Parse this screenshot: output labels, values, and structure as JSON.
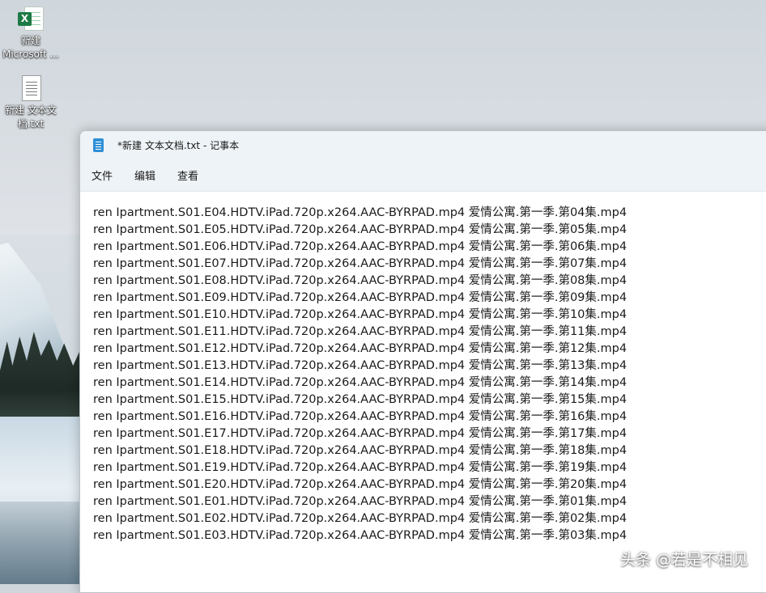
{
  "desktop": {
    "icons": [
      {
        "name": "excel-file",
        "label_line1": "新建",
        "label_line2": "Microsoft ...",
        "badge": "X"
      },
      {
        "name": "text-file",
        "label_line1": "新建 文本文",
        "label_line2": "档.txt"
      }
    ]
  },
  "window": {
    "title": "*新建 文本文档.txt - 记事本",
    "menu": [
      "文件",
      "编辑",
      "查看"
    ]
  },
  "editor": {
    "lines": [
      "ren Ipartment.S01.E04.HDTV.iPad.720p.x264.AAC-BYRPAD.mp4 爱情公寓.第一季.第04集.mp4",
      "ren Ipartment.S01.E05.HDTV.iPad.720p.x264.AAC-BYRPAD.mp4 爱情公寓.第一季.第05集.mp4",
      "ren Ipartment.S01.E06.HDTV.iPad.720p.x264.AAC-BYRPAD.mp4 爱情公寓.第一季.第06集.mp4",
      "ren Ipartment.S01.E07.HDTV.iPad.720p.x264.AAC-BYRPAD.mp4 爱情公寓.第一季.第07集.mp4",
      "ren Ipartment.S01.E08.HDTV.iPad.720p.x264.AAC-BYRPAD.mp4 爱情公寓.第一季.第08集.mp4",
      "ren Ipartment.S01.E09.HDTV.iPad.720p.x264.AAC-BYRPAD.mp4 爱情公寓.第一季.第09集.mp4",
      "ren Ipartment.S01.E10.HDTV.iPad.720p.x264.AAC-BYRPAD.mp4 爱情公寓.第一季.第10集.mp4",
      "ren Ipartment.S01.E11.HDTV.iPad.720p.x264.AAC-BYRPAD.mp4 爱情公寓.第一季.第11集.mp4",
      "ren Ipartment.S01.E12.HDTV.iPad.720p.x264.AAC-BYRPAD.mp4 爱情公寓.第一季.第12集.mp4",
      "ren Ipartment.S01.E13.HDTV.iPad.720p.x264.AAC-BYRPAD.mp4 爱情公寓.第一季.第13集.mp4",
      "ren Ipartment.S01.E14.HDTV.iPad.720p.x264.AAC-BYRPAD.mp4 爱情公寓.第一季.第14集.mp4",
      "ren Ipartment.S01.E15.HDTV.iPad.720p.x264.AAC-BYRPAD.mp4 爱情公寓.第一季.第15集.mp4",
      "ren Ipartment.S01.E16.HDTV.iPad.720p.x264.AAC-BYRPAD.mp4 爱情公寓.第一季.第16集.mp4",
      "ren Ipartment.S01.E17.HDTV.iPad.720p.x264.AAC-BYRPAD.mp4 爱情公寓.第一季.第17集.mp4",
      "ren Ipartment.S01.E18.HDTV.iPad.720p.x264.AAC-BYRPAD.mp4 爱情公寓.第一季.第18集.mp4",
      "ren Ipartment.S01.E19.HDTV.iPad.720p.x264.AAC-BYRPAD.mp4 爱情公寓.第一季.第19集.mp4",
      "ren Ipartment.S01.E20.HDTV.iPad.720p.x264.AAC-BYRPAD.mp4 爱情公寓.第一季.第20集.mp4",
      "ren Ipartment.S01.E01.HDTV.iPad.720p.x264.AAC-BYRPAD.mp4 爱情公寓.第一季.第01集.mp4",
      "ren Ipartment.S01.E02.HDTV.iPad.720p.x264.AAC-BYRPAD.mp4 爱情公寓.第一季.第02集.mp4",
      "ren Ipartment.S01.E03.HDTV.iPad.720p.x264.AAC-BYRPAD.mp4 爱情公寓.第一季.第03集.mp4"
    ]
  },
  "watermark": "头条 @若是不相见",
  "colors": {
    "titlebar_bg": "#eef3f7",
    "editor_bg": "#ffffff",
    "text": "#1b1b1b",
    "excel_green": "#1d7a45",
    "notepad_blue": "#2f8fd6"
  }
}
